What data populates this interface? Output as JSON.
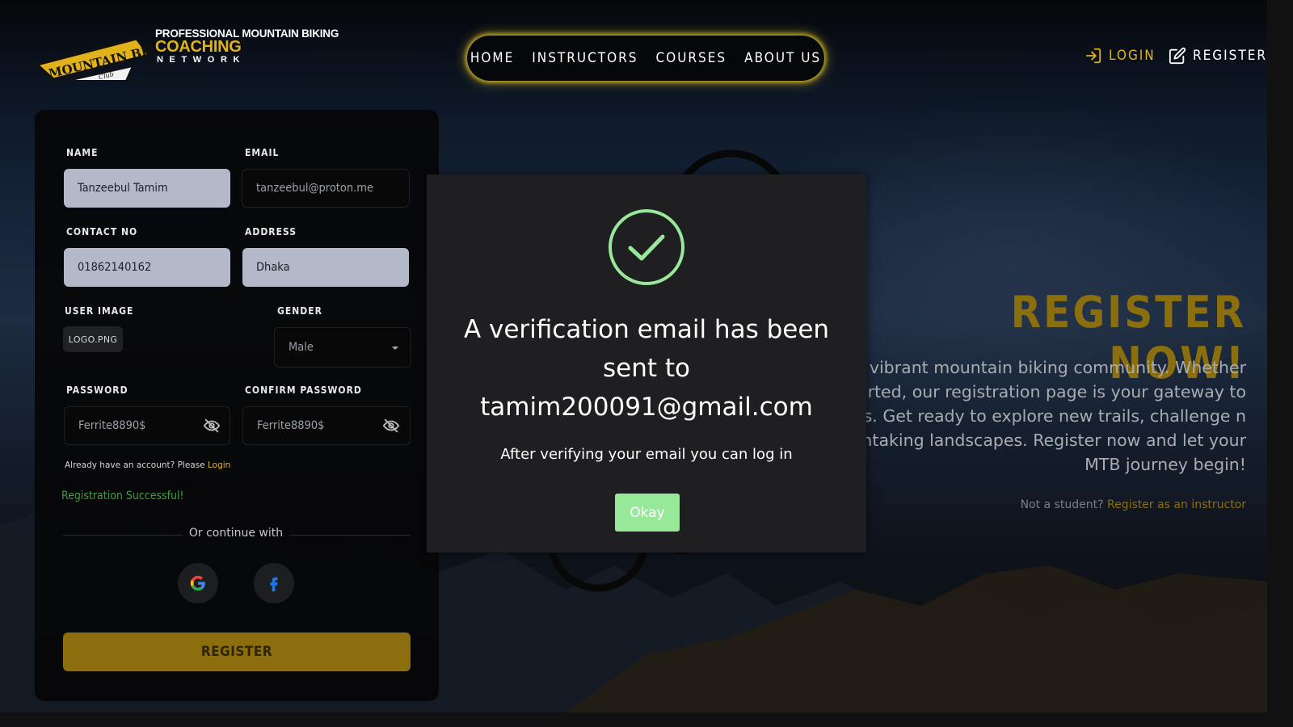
{
  "brand": {
    "badge_text": "MOUNTAIN BIKE",
    "badge_sub": "Club",
    "line1": "PROFESSIONAL MOUNTAIN BIKING",
    "line2": "COACHING",
    "line3": "NETWORK"
  },
  "nav": {
    "items": [
      "HOME",
      "INSTRUCTORS",
      "COURSES",
      "ABOUT US"
    ]
  },
  "auth": {
    "login_label": "LOGIN",
    "register_label": "REGISTER"
  },
  "form": {
    "name_label": "NAME",
    "name_value": "Tanzeebul Tamim",
    "email_label": "EMAIL",
    "email_value": "tanzeebul@proton.me",
    "contact_label": "CONTACT NO",
    "contact_value": "01862140162",
    "address_label": "ADDRESS",
    "address_value": "Dhaka",
    "image_label": "USER IMAGE",
    "image_value": "LOGO.PNG",
    "gender_label": "GENDER",
    "gender_value": "Male",
    "password_label": "PASSWORD",
    "password_value": "Ferrite8890$",
    "confirm_label": "CONFIRM PASSWORD",
    "confirm_value": "Ferrite8890$",
    "have_account": "Already have an account? Please",
    "login_link": "Login",
    "success": "Registration Successful!",
    "or_continue": "Or continue with",
    "register_button": "REGISTER"
  },
  "hero": {
    "title": "REGISTER NOW!",
    "text": "ur vibrant mountain biking community. Whether started, our registration page is your gateway to unities. Get ready to explore new trails, challenge n breathtaking landscapes. Register now and let your MTB journey begin!",
    "note_prefix": "Not a student?",
    "note_link": "Register as an instructor"
  },
  "modal": {
    "title": "A verification email has been sent to tamim200091@gmail.com",
    "subtitle": "After verifying your email you can log in",
    "ok_button": "Okay"
  },
  "colors": {
    "accent": "#e2b21a",
    "success_check": "#98e89a",
    "modal_bg": "#1f1f21"
  }
}
